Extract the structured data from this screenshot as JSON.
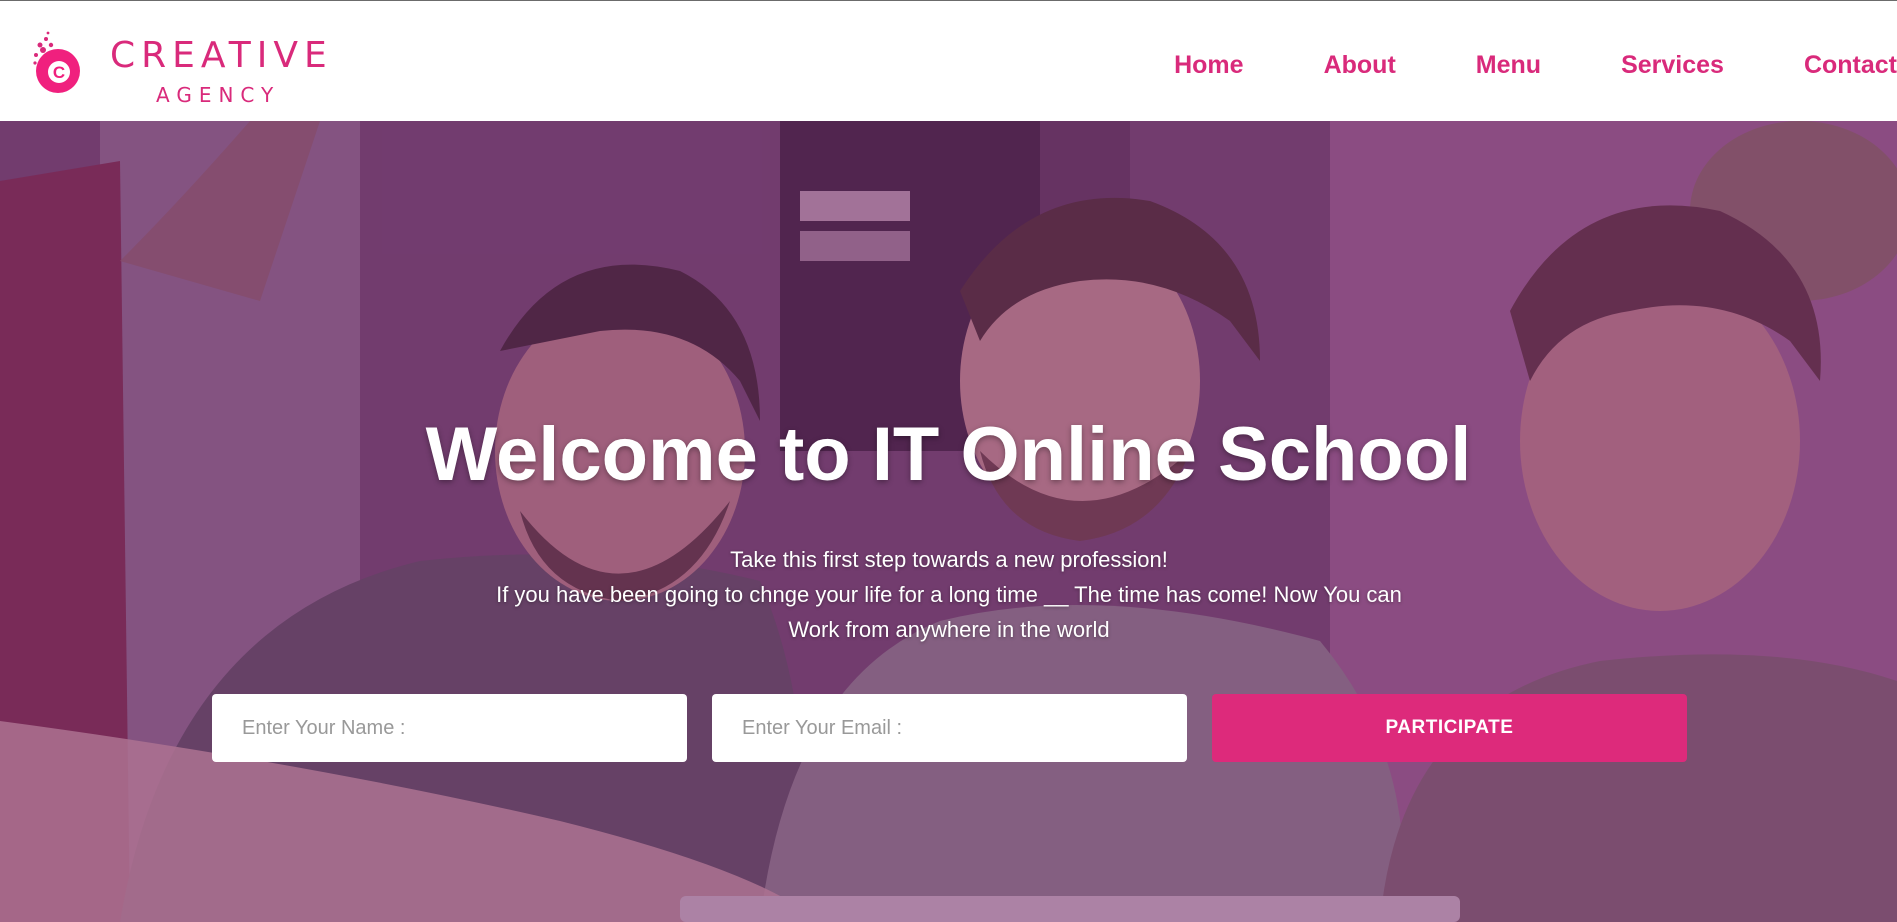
{
  "brand": {
    "logo_letter": "C",
    "title": "CREATIVE",
    "subtitle": "AGENCY"
  },
  "nav": {
    "items": [
      {
        "label": "Home"
      },
      {
        "label": "About"
      },
      {
        "label": "Menu"
      },
      {
        "label": "Services"
      },
      {
        "label": "Contact"
      }
    ]
  },
  "hero": {
    "title": "Welcome to IT Online School",
    "lines": [
      "Take this first step towards a new profession!",
      "If you have been going to chnge your life for a long time __ The time has come! Now You can",
      "Work from anywhere in the world"
    ],
    "image": "photo of three smiling young men"
  },
  "form": {
    "name_placeholder": "Enter Your Name :",
    "email_placeholder": "Enter Your Email :",
    "submit_label": "PARTICIPATE"
  },
  "colors": {
    "accent": "#d92a7b",
    "button": "#dd2a7b",
    "overlay": "#7a2f6e"
  },
  "icons": {
    "logo": "creative-agency-logo-icon"
  }
}
